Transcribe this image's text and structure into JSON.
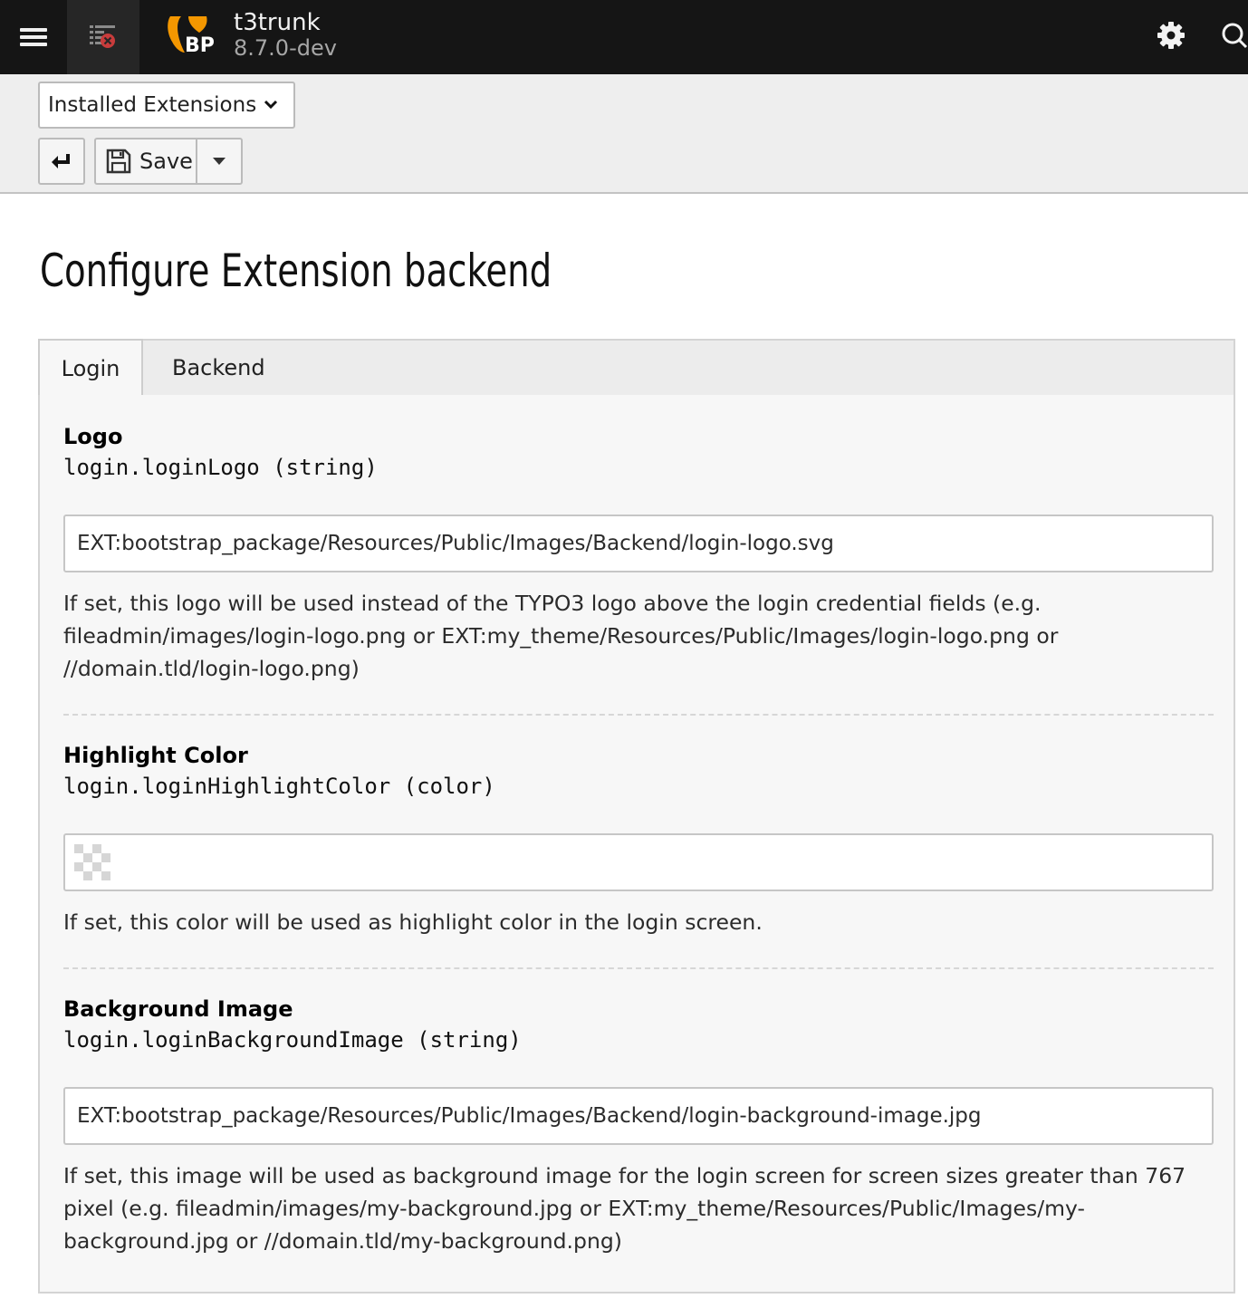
{
  "topbar": {
    "site_name": "t3trunk",
    "site_version": "8.7.0-dev",
    "logo_text": "BP",
    "icons": [
      "menu-icon",
      "cache-clear-icon",
      "gear-icon",
      "search-icon"
    ]
  },
  "docheader": {
    "module_menu": {
      "selected": "Installed Extensions"
    },
    "save_label": "Save"
  },
  "page": {
    "title": "Configure Extension backend"
  },
  "tabs": [
    {
      "label": "Login",
      "active": true
    },
    {
      "label": "Backend",
      "active": false
    }
  ],
  "fields": [
    {
      "title": "Logo",
      "key": "login.loginLogo (string)",
      "value": "EXT:bootstrap_package/Resources/Public/Images/Backend/login-logo.svg",
      "description": "If set, this logo will be used instead of the TYPO3 logo above the login credential fields (e.g. fileadmin/images/login-logo.png or EXT:my_theme/Resources/Public/Images/login-logo.png or //domain.tld/login-logo.png)"
    },
    {
      "title": "Highlight Color",
      "key": "login.loginHighlightColor (color)",
      "value": "",
      "description": "If set, this color will be used as highlight color in the login screen."
    },
    {
      "title": "Background Image",
      "key": "login.loginBackgroundImage (string)",
      "value": "EXT:bootstrap_package/Resources/Public/Images/Backend/login-background-image.jpg",
      "description": "If set, this image will be used as background image for the login screen for screen sizes greater than 767 pixel (e.g. fileadmin/images/my-background.jpg or EXT:my_theme/Resources/Public/Images/my-background.jpg or //domain.tld/my-background.png)"
    }
  ],
  "colors": {
    "topbar_bg": "#151515",
    "logo_orange": "#f49700",
    "docheader_bg": "#eeeeee",
    "panel_bg": "#f7f7f7"
  }
}
